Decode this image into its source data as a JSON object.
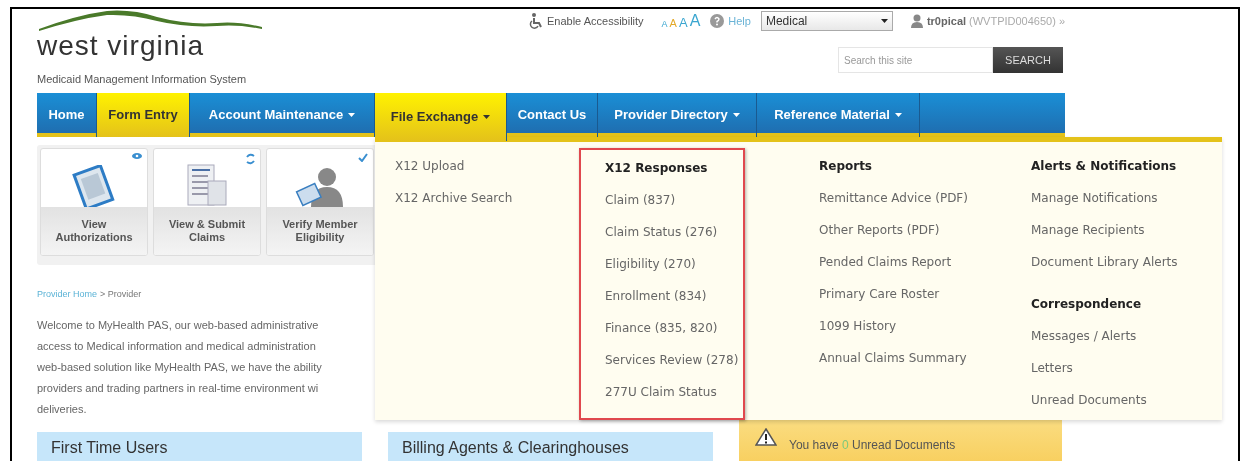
{
  "header": {
    "logo_title": "west virginia",
    "logo_subtitle": "Medicaid Management Information System"
  },
  "utility_bar": {
    "accessibility_link": "Enable Accessibility",
    "font_sizes": [
      {
        "label": "A",
        "selected": false
      },
      {
        "label": "A",
        "selected": true
      },
      {
        "label": "A",
        "selected": false
      },
      {
        "label": "A",
        "selected": false
      }
    ],
    "help_link": "Help",
    "program_select": "Medical",
    "user_name": "tr0pical",
    "user_id": "(WVTPID004650)",
    "user_menu_glyph": "»"
  },
  "search": {
    "placeholder": "Search this site",
    "button": "SEARCH"
  },
  "nav": [
    {
      "label": "Home",
      "kind": "plain",
      "has_menu": false,
      "selected": false
    },
    {
      "label": "Form Entry",
      "kind": "featured",
      "has_menu": false,
      "selected": false
    },
    {
      "label": "Account Maintenance",
      "kind": "plain",
      "has_menu": true,
      "selected": false
    },
    {
      "label": "File Exchange",
      "kind": "plain",
      "has_menu": true,
      "selected": true
    },
    {
      "label": "Contact Us",
      "kind": "plain",
      "has_menu": false,
      "selected": false
    },
    {
      "label": "Provider Directory",
      "kind": "plain",
      "has_menu": true,
      "selected": false
    },
    {
      "label": "Reference Material",
      "kind": "plain",
      "has_menu": true,
      "selected": false
    }
  ],
  "dropdown": {
    "columns": [
      {
        "highlighted": false,
        "groups": [
          {
            "items": [
              "X12 Upload",
              "X12 Archive Search"
            ]
          }
        ]
      },
      {
        "highlighted": true,
        "groups": [
          {
            "heading": "X12 Responses",
            "items": [
              "Claim (837)",
              "Claim Status (276)",
              "Eligibility (270)",
              "Enrollment (834)",
              "Finance (835, 820)",
              "Services Review (278)",
              "277U Claim Status"
            ]
          }
        ]
      },
      {
        "highlighted": false,
        "groups": [
          {
            "heading": "Reports",
            "items": [
              "Remittance Advice (PDF)",
              "Other Reports (PDF)",
              "Pended Claims Report",
              "Primary Care Roster",
              "1099 History",
              "Annual Claims Summary"
            ]
          }
        ]
      },
      {
        "highlighted": false,
        "groups": [
          {
            "heading": "Alerts & Notifications",
            "items": [
              "Manage Notifications",
              "Manage Recipients",
              "Document Library Alerts"
            ]
          },
          {
            "heading": "Correspondence",
            "items": [
              "Messages / Alerts",
              "Letters",
              "Unread Documents"
            ]
          }
        ]
      }
    ]
  },
  "tiles": [
    {
      "label": "View Authorizations",
      "kind": "authorizations"
    },
    {
      "label": "View & Submit Claims",
      "kind": "claims"
    },
    {
      "label": "Verify Member Eligibility",
      "kind": "eligibility"
    }
  ],
  "breadcrumb": {
    "link": "Provider Home",
    "current": "> Provider"
  },
  "intro_lines": [
    "Welcome to MyHealth PAS, our web-based administrative",
    "access to Medical information and medical administration",
    "web-based solution like MyHealth PAS, we have the ability",
    "providers and trading partners in real-time environment wi",
    "deliveries."
  ],
  "panels": [
    {
      "title": "First Time Users"
    },
    {
      "title": "Billing Agents & Clearinghouses"
    }
  ],
  "alert": {
    "text_before": "You have",
    "count": "0",
    "text_after": "Unread Documents"
  }
}
